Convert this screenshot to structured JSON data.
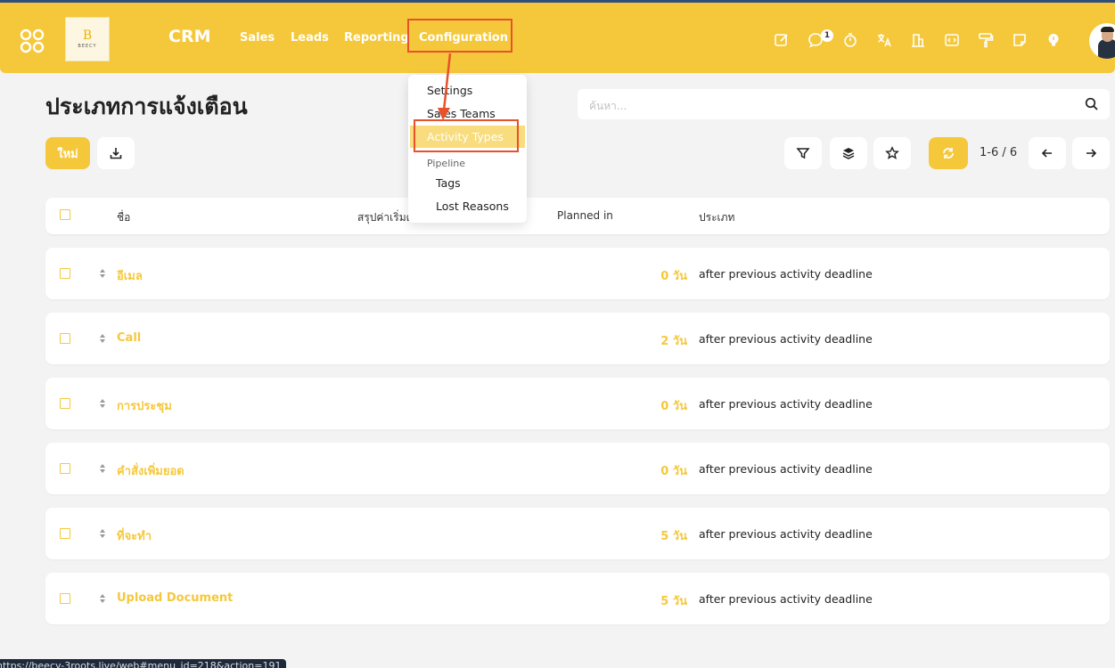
{
  "navbar": {
    "app_name": "CRM",
    "logo_text": "BEECY",
    "logo_mark": "B",
    "menu": [
      "Sales",
      "Leads",
      "Reporting",
      "Configuration"
    ],
    "chat_badge": "1",
    "accent_color": "#f5c83b",
    "annotation_color": "#e8512a",
    "icons": [
      "edit-icon",
      "chat-icon",
      "timer-icon",
      "translate-icon",
      "building-icon",
      "code-icon",
      "paint-roller-icon",
      "note-icon",
      "lightbulb-icon"
    ]
  },
  "page": {
    "title": "ประเภทการแจ้งเตือน",
    "new_button": "ใหม่",
    "search_placeholder": "ค้นหา...",
    "pager": "1-6 / 6"
  },
  "table": {
    "columns": [
      "ชื่อ",
      "สรุปค่าเริ่มต้น",
      "Planned in",
      "ประเภท"
    ],
    "rows": [
      {
        "name": "อีเมล",
        "planned": "0 วัน",
        "type": "after previous activity deadline"
      },
      {
        "name": "Call",
        "planned": "2 วัน",
        "type": "after previous activity deadline"
      },
      {
        "name": "การประชุม",
        "planned": "0 วัน",
        "type": "after previous activity deadline"
      },
      {
        "name": "คำสั่งเพิ่มยอด",
        "planned": "0 วัน",
        "type": "after previous activity deadline"
      },
      {
        "name": "ที่จะทำ",
        "planned": "5 วัน",
        "type": "after previous activity deadline"
      },
      {
        "name": "Upload Document",
        "planned": "5 วัน",
        "type": "after previous activity deadline"
      }
    ]
  },
  "dropdown": {
    "settings": "Settings",
    "sales_teams": "Sales Teams",
    "activity_types": "Activity Types",
    "pipeline_header": "Pipeline",
    "tags": "Tags",
    "lost_reasons": "Lost Reasons"
  },
  "statusbar": {
    "url": "https://beecy-3roots.live/web#menu_id=218&action=191"
  }
}
